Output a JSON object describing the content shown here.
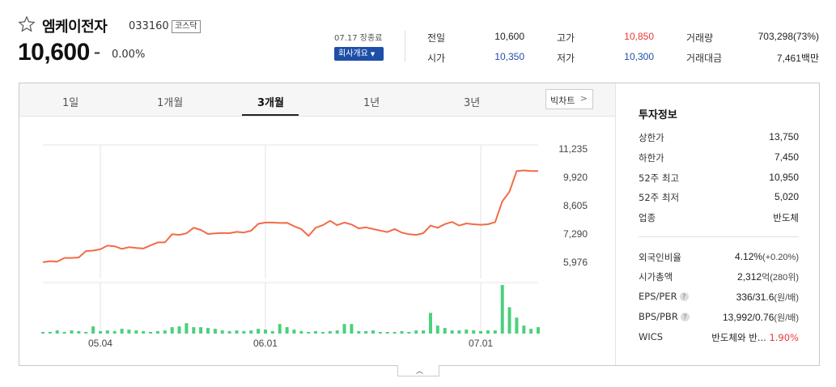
{
  "header": {
    "stock_name": "엠케이전자",
    "stock_code": "033160",
    "market": "코스닥",
    "price": "10,600",
    "change_symbol": "–",
    "change_rate": "0.00%",
    "close_label": "07.17 장종료",
    "overview_button": "회사개요"
  },
  "summary": {
    "prev_close_label": "전일",
    "prev_close": "10,600",
    "high_label": "고가",
    "high": "10,850",
    "volume_label": "거래량",
    "volume": "703,298(73%)",
    "open_label": "시가",
    "open": "10,350",
    "low_label": "저가",
    "low": "10,300",
    "amount_label": "거래대금",
    "amount": "7,461백만"
  },
  "tabs": [
    "1일",
    "1개월",
    "3개월",
    "1년",
    "3년"
  ],
  "active_tab": "3개월",
  "big_chart_button": "빅차트",
  "colors": {
    "up": "#e53935",
    "down": "#1e4fa8",
    "price_line": "#f26b47",
    "volume_bar": "#4cd07d"
  },
  "invest": {
    "title": "투자정보",
    "upper_limit_label": "상한가",
    "upper_limit": "13,750",
    "lower_limit_label": "하한가",
    "lower_limit": "7,450",
    "high52_label": "52주 최고",
    "high52": "10,950",
    "low52_label": "52주 최저",
    "low52": "5,020",
    "sector_label": "업종",
    "sector": "반도체",
    "foreign_label": "외국인비율",
    "foreign": "4.12%",
    "foreign_change": "(+0.20%)",
    "marketcap_label": "시가총액",
    "marketcap": "2,312",
    "marketcap_unit": "억(280위)",
    "eps_per_label": "EPS/PER",
    "eps_per": "336/31.6",
    "eps_per_unit": "(원/배)",
    "bps_pbr_label": "BPS/PBR",
    "bps_pbr": "13,992/0.76",
    "bps_pbr_unit": "(원/배)",
    "wics_label": "WICS",
    "wics": "반도체와 반...",
    "wics_change": "1.90%"
  },
  "chart_data": {
    "type": "line",
    "x_tick_labels": [
      "05.04",
      "06.01",
      "07.01"
    ],
    "x_tick_index": [
      8,
      31,
      61
    ],
    "y_ticks": [
      5976,
      7290,
      8605,
      9920,
      11235
    ],
    "ylim": [
      5976,
      11235
    ],
    "series": [
      {
        "values": [
          5980,
          6030,
          6010,
          6180,
          6180,
          6200,
          6500,
          6520,
          6580,
          6750,
          6720,
          6600,
          6680,
          6640,
          6620,
          6760,
          6900,
          6900,
          7280,
          7250,
          7320,
          7580,
          7480,
          7290,
          7320,
          7340,
          7330,
          7390,
          7360,
          7440,
          7760,
          7820,
          7820,
          7800,
          7810,
          7650,
          7520,
          7200,
          7580,
          7700,
          7900,
          7700,
          7820,
          7730,
          7550,
          7600,
          7520,
          7450,
          7380,
          7520,
          7350,
          7280,
          7250,
          7330,
          7680,
          7580,
          7750,
          7850,
          7680,
          7780,
          7740,
          7720,
          7740,
          7840,
          8810,
          9250,
          10210,
          10240,
          10210,
          10210
        ]
      }
    ],
    "volume": [
      2,
      2,
      4,
      2,
      4,
      3,
      2,
      9,
      3,
      4,
      3,
      6,
      5,
      4,
      3,
      2,
      3,
      4,
      8,
      9,
      13,
      8,
      8,
      7,
      6,
      4,
      3,
      4,
      3,
      4,
      6,
      5,
      3,
      12,
      8,
      5,
      3,
      2,
      3,
      2,
      3,
      4,
      12,
      12,
      3,
      3,
      4,
      2,
      2,
      2,
      3,
      2,
      4,
      4,
      26,
      10,
      7,
      4,
      4,
      5,
      4,
      3,
      4,
      4,
      61,
      33,
      20,
      10,
      6,
      8
    ]
  }
}
